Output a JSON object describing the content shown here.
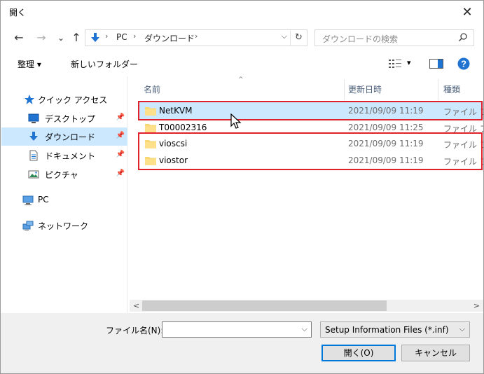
{
  "window": {
    "title": "開く",
    "close_glyph": "✕"
  },
  "navigation": {
    "back_glyph": "←",
    "forward_glyph": "→",
    "recent_glyph": "⌄",
    "up_glyph": "↑",
    "breadcrumb": [
      "PC",
      "ダウンロード"
    ],
    "separator": "›",
    "dropdown_glyph": "⌵",
    "refresh_glyph": "↻",
    "search_placeholder": "ダウンロードの検索"
  },
  "toolbar": {
    "organize_label": "整理 ▾",
    "new_folder_label": "新しいフォルダー",
    "view_dropdown_glyph": "▾"
  },
  "sidebar": {
    "items": [
      {
        "label": "クイック アクセス",
        "icon": "star-icon"
      },
      {
        "label": "デスクトップ",
        "icon": "desktop-icon",
        "pinned": true
      },
      {
        "label": "ダウンロード",
        "icon": "download-icon",
        "pinned": true,
        "selected": true
      },
      {
        "label": "ドキュメント",
        "icon": "document-icon",
        "pinned": true
      },
      {
        "label": "ピクチャ",
        "icon": "pictures-icon",
        "pinned": true
      },
      {
        "label": "PC",
        "icon": "pc-icon"
      },
      {
        "label": "ネットワーク",
        "icon": "network-icon"
      }
    ],
    "pin_glyph": "📌"
  },
  "file_list": {
    "columns": [
      "名前",
      "更新日時",
      "種類"
    ],
    "sort_glyph": "^",
    "rows": [
      {
        "name": "NetKVM",
        "modified": "2021/09/09 11:19",
        "type": "ファイル フォ",
        "selected": true
      },
      {
        "name": "T00002316",
        "modified": "2021/09/09 11:25",
        "type": "ファイル フォ"
      },
      {
        "name": "vioscsi",
        "modified": "2021/09/09 11:19",
        "type": "ファイル フォ"
      },
      {
        "name": "viostor",
        "modified": "2021/09/09 11:19",
        "type": "ファイル フォ"
      }
    ]
  },
  "scrollbar": {
    "left_glyph": "<",
    "right_glyph": ">"
  },
  "footer": {
    "filename_label": "ファイル名(N):",
    "filename_value": "",
    "filetype_value": "Setup Information Files (*.inf)",
    "dropdown_glyph": "⌵",
    "open_label": "開く(O)",
    "cancel_label": "キャンセル"
  },
  "colors": {
    "selection": "#cce8ff",
    "highlight_box": "#e0202a",
    "folder": "#f8d775",
    "accent": "#0078d7"
  }
}
